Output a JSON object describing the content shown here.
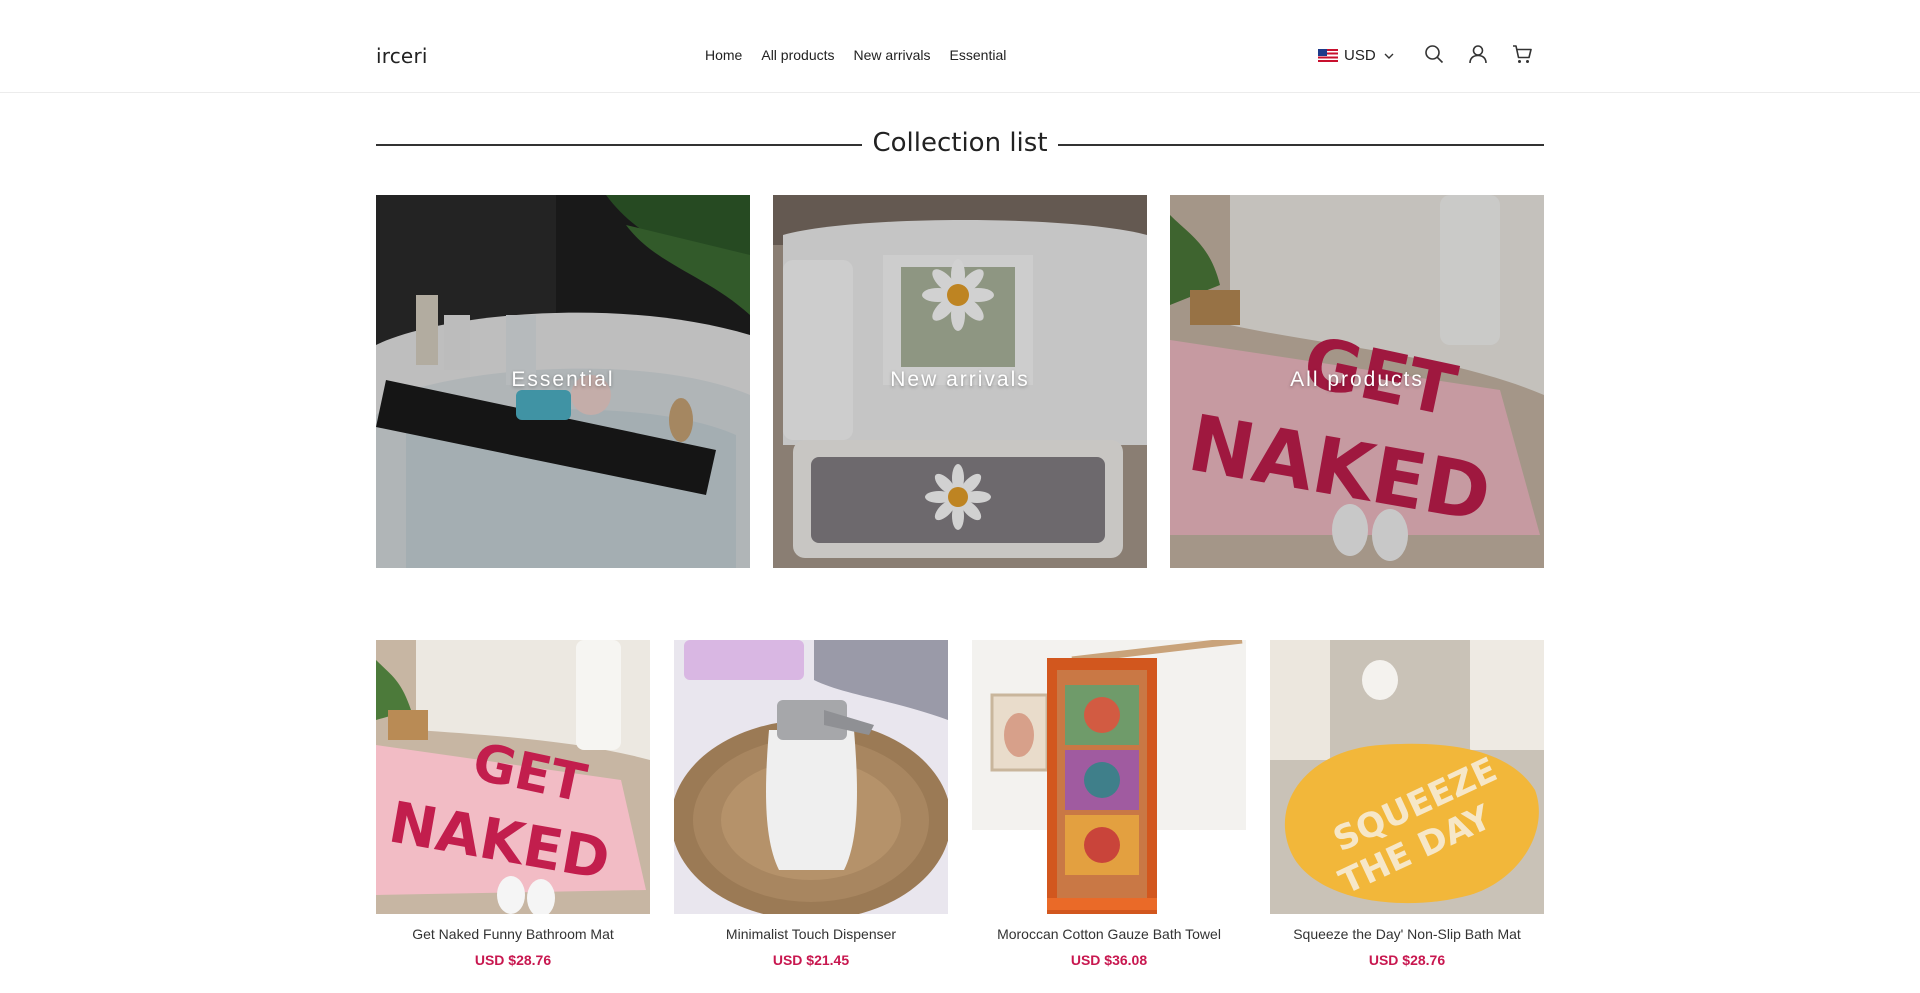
{
  "brand": "irceri",
  "nav": [
    "Home",
    "All products",
    "New arrivals",
    "Essential"
  ],
  "currency": {
    "code": "USD",
    "flag": "us-flag-icon"
  },
  "header_icons": [
    "search-icon",
    "account-icon",
    "cart-icon"
  ],
  "collection_section": {
    "title": "Collection list"
  },
  "collections": [
    {
      "label": "Essential"
    },
    {
      "label": "New arrivals"
    },
    {
      "label": "All products"
    }
  ],
  "products": [
    {
      "name": "Get Naked Funny Bathroom Mat",
      "price": "USD $28.76"
    },
    {
      "name": "Minimalist Touch Dispenser",
      "price": "USD $21.45"
    },
    {
      "name": "Moroccan Cotton Gauze Bath Towel",
      "price": "USD $36.08"
    },
    {
      "name": "Squeeze the Day' Non-Slip Bath Mat",
      "price": "USD $28.76"
    }
  ],
  "colors": {
    "price": "#c8174f",
    "text": "#222222",
    "divider": "#333333"
  }
}
